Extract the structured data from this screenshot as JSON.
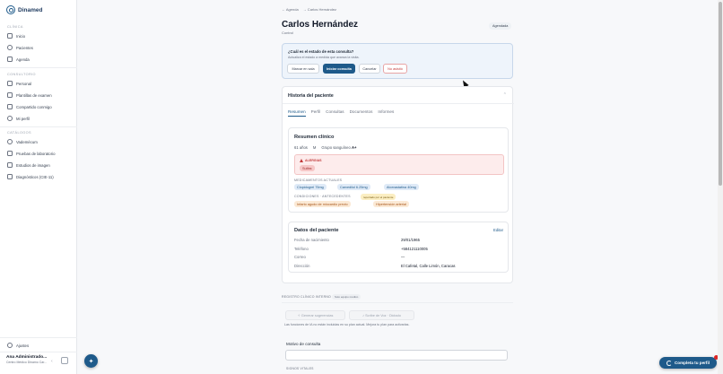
{
  "brand": {
    "name": "Dinamed"
  },
  "sidebar": {
    "sections": {
      "clinica": "CLÍNICA",
      "consultorio": "CONSULTORIO",
      "catalogos": "CATÁLOGOS"
    },
    "clinica_items": [
      {
        "label": "Inicio",
        "icon": "home-icon"
      },
      {
        "label": "Pacientes",
        "icon": "users-icon"
      },
      {
        "label": "Agenda",
        "icon": "calendar-icon"
      }
    ],
    "consultorio_items": [
      {
        "label": "Personal",
        "icon": "id-badge-icon"
      },
      {
        "label": "Plantillas de examen",
        "icon": "template-icon"
      },
      {
        "label": "Compartido conmigo",
        "icon": "share-icon"
      },
      {
        "label": "Mi perfil",
        "icon": "user-icon"
      }
    ],
    "catalogos_items": [
      {
        "label": "Vademécum",
        "icon": "pill-icon"
      },
      {
        "label": "Pruebas de laboratorio",
        "icon": "flask-icon"
      },
      {
        "label": "Estudios de imagen",
        "icon": "image-icon"
      },
      {
        "label": "Diagnósticos (CIE-11)",
        "icon": "list-icon"
      }
    ],
    "settings_label": "Ajustes",
    "user_name": "Ana Administrado...",
    "user_sub": "Centro Médico Dinamo Car..."
  },
  "breadcrumb": {
    "back": "← Agenda",
    "current": "→ Carlos Hernández"
  },
  "patient": {
    "name": "Carlos Hernández",
    "type": "Control",
    "status_badge": "Agendada"
  },
  "consult_status": {
    "question": "¿Cuál es el estado de esta consulta?",
    "hint": "Actualiza el estado a medida que avanza la visita.",
    "buttons": [
      "Marcar en sala",
      "Iniciar consulta",
      "Cancelar",
      "No asistió"
    ]
  },
  "history": {
    "title": "Historia del paciente",
    "tabs": [
      "Resumen",
      "Perfil",
      "Consultas",
      "Documentos",
      "Informes"
    ],
    "summary": {
      "title": "Resumen clínico",
      "age": "61 años",
      "sex": "M",
      "blood_label": "Grupo sanguíneo",
      "blood_value": "A+",
      "allergies_label": "ALERGIAS",
      "allergies": [
        "Sulfas"
      ],
      "meds_label": "MEDICAMENTOS ACTUALES",
      "meds": [
        "Clopidogrel 75mg",
        "Carvedilol 6.25mg",
        "Atorvastatina 40mg"
      ],
      "conditions_label": "CONDICIONES · ANTECEDENTES",
      "conditions_tag": "reportado por el paciente",
      "conditions": [
        "Infarto agudo de miocardio previo",
        "Hipertensión arterial"
      ]
    },
    "patient_data": {
      "title": "Datos del paciente",
      "edit": "Editar",
      "rows": [
        {
          "label": "Fecha de nacimiento",
          "value": "29/01/1965"
        },
        {
          "label": "Teléfono",
          "value": "+584121110005"
        },
        {
          "label": "Correo",
          "value": "—"
        },
        {
          "label": "Dirección",
          "value": "El Cafetal, Calle Limón, Caracas"
        }
      ]
    }
  },
  "clinical": {
    "section_label": "REGISTRO CLÍNICO INTERNO",
    "section_pill": "Solo equipo médico",
    "buttons": [
      "Generar sugerencias",
      "Scribe de Voz · Dictado"
    ],
    "note": "Las funciones de IA no están incluidas en su plan actual. Mejora tu plan para activarlas.",
    "motivo_label": "Motivo de consulta",
    "vitals_label": "SIGNOS VITALES"
  },
  "cta": {
    "complete_profile": "Completa tu perfil"
  },
  "colors": {
    "primary": "#1e5a8a",
    "danger": "#c23b3b",
    "background": "#f7f8fa"
  }
}
